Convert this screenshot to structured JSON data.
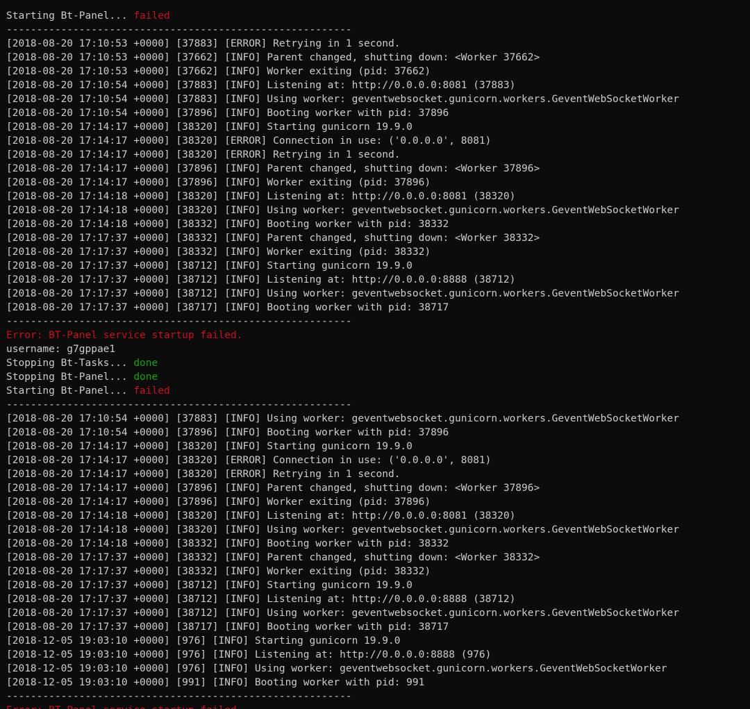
{
  "terminal": {
    "lines": [
      {
        "text": "",
        "status": "",
        "kind": "plain"
      },
      {
        "text": "Starting Bt-Panel... ",
        "status": "failed",
        "kind": "status"
      },
      {
        "text": "---------------------------------------------------------",
        "status": "",
        "kind": "sep"
      },
      {
        "text": "[2018-08-20 17:10:53 +0000] [37883] [ERROR] Retrying in 1 second.",
        "status": "",
        "kind": "plain"
      },
      {
        "text": "[2018-08-20 17:10:53 +0000] [37662] [INFO] Parent changed, shutting down: <Worker 37662>",
        "status": "",
        "kind": "plain"
      },
      {
        "text": "[2018-08-20 17:10:53 +0000] [37662] [INFO] Worker exiting (pid: 37662)",
        "status": "",
        "kind": "plain"
      },
      {
        "text": "[2018-08-20 17:10:54 +0000] [37883] [INFO] Listening at: http://0.0.0.0:8081 (37883)",
        "status": "",
        "kind": "plain"
      },
      {
        "text": "[2018-08-20 17:10:54 +0000] [37883] [INFO] Using worker: geventwebsocket.gunicorn.workers.GeventWebSocketWorker",
        "status": "",
        "kind": "plain"
      },
      {
        "text": "[2018-08-20 17:10:54 +0000] [37896] [INFO] Booting worker with pid: 37896",
        "status": "",
        "kind": "plain"
      },
      {
        "text": "[2018-08-20 17:14:17 +0000] [38320] [INFO] Starting gunicorn 19.9.0",
        "status": "",
        "kind": "plain"
      },
      {
        "text": "[2018-08-20 17:14:17 +0000] [38320] [ERROR] Connection in use: ('0.0.0.0', 8081)",
        "status": "",
        "kind": "plain"
      },
      {
        "text": "[2018-08-20 17:14:17 +0000] [38320] [ERROR] Retrying in 1 second.",
        "status": "",
        "kind": "plain"
      },
      {
        "text": "[2018-08-20 17:14:17 +0000] [37896] [INFO] Parent changed, shutting down: <Worker 37896>",
        "status": "",
        "kind": "plain"
      },
      {
        "text": "[2018-08-20 17:14:17 +0000] [37896] [INFO] Worker exiting (pid: 37896)",
        "status": "",
        "kind": "plain"
      },
      {
        "text": "[2018-08-20 17:14:18 +0000] [38320] [INFO] Listening at: http://0.0.0.0:8081 (38320)",
        "status": "",
        "kind": "plain"
      },
      {
        "text": "[2018-08-20 17:14:18 +0000] [38320] [INFO] Using worker: geventwebsocket.gunicorn.workers.GeventWebSocketWorker",
        "status": "",
        "kind": "plain"
      },
      {
        "text": "[2018-08-20 17:14:18 +0000] [38332] [INFO] Booting worker with pid: 38332",
        "status": "",
        "kind": "plain"
      },
      {
        "text": "[2018-08-20 17:17:37 +0000] [38332] [INFO] Parent changed, shutting down: <Worker 38332>",
        "status": "",
        "kind": "plain"
      },
      {
        "text": "[2018-08-20 17:17:37 +0000] [38332] [INFO] Worker exiting (pid: 38332)",
        "status": "",
        "kind": "plain"
      },
      {
        "text": "[2018-08-20 17:17:37 +0000] [38712] [INFO] Starting gunicorn 19.9.0",
        "status": "",
        "kind": "plain"
      },
      {
        "text": "[2018-08-20 17:17:37 +0000] [38712] [INFO] Listening at: http://0.0.0.0:8888 (38712)",
        "status": "",
        "kind": "plain"
      },
      {
        "text": "[2018-08-20 17:17:37 +0000] [38712] [INFO] Using worker: geventwebsocket.gunicorn.workers.GeventWebSocketWorker",
        "status": "",
        "kind": "plain"
      },
      {
        "text": "[2018-08-20 17:17:37 +0000] [38717] [INFO] Booting worker with pid: 38717",
        "status": "",
        "kind": "plain"
      },
      {
        "text": "---------------------------------------------------------",
        "status": "",
        "kind": "sep"
      },
      {
        "text": "Error: BT-Panel service startup failed.",
        "status": "",
        "kind": "error"
      },
      {
        "text": "username: g7gppae1",
        "status": "",
        "kind": "plain"
      },
      {
        "text": "Stopping Bt-Tasks... ",
        "status": "done",
        "kind": "status"
      },
      {
        "text": "Stopping Bt-Panel... ",
        "status": "done",
        "kind": "status"
      },
      {
        "text": "Starting Bt-Panel... ",
        "status": "failed",
        "kind": "status"
      },
      {
        "text": "---------------------------------------------------------",
        "status": "",
        "kind": "sep"
      },
      {
        "text": "[2018-08-20 17:10:54 +0000] [37883] [INFO] Using worker: geventwebsocket.gunicorn.workers.GeventWebSocketWorker",
        "status": "",
        "kind": "plain"
      },
      {
        "text": "[2018-08-20 17:10:54 +0000] [37896] [INFO] Booting worker with pid: 37896",
        "status": "",
        "kind": "plain"
      },
      {
        "text": "[2018-08-20 17:14:17 +0000] [38320] [INFO] Starting gunicorn 19.9.0",
        "status": "",
        "kind": "plain"
      },
      {
        "text": "[2018-08-20 17:14:17 +0000] [38320] [ERROR] Connection in use: ('0.0.0.0', 8081)",
        "status": "",
        "kind": "plain"
      },
      {
        "text": "[2018-08-20 17:14:17 +0000] [38320] [ERROR] Retrying in 1 second.",
        "status": "",
        "kind": "plain"
      },
      {
        "text": "[2018-08-20 17:14:17 +0000] [37896] [INFO] Parent changed, shutting down: <Worker 37896>",
        "status": "",
        "kind": "plain"
      },
      {
        "text": "[2018-08-20 17:14:17 +0000] [37896] [INFO] Worker exiting (pid: 37896)",
        "status": "",
        "kind": "plain"
      },
      {
        "text": "[2018-08-20 17:14:18 +0000] [38320] [INFO] Listening at: http://0.0.0.0:8081 (38320)",
        "status": "",
        "kind": "plain"
      },
      {
        "text": "[2018-08-20 17:14:18 +0000] [38320] [INFO] Using worker: geventwebsocket.gunicorn.workers.GeventWebSocketWorker",
        "status": "",
        "kind": "plain"
      },
      {
        "text": "[2018-08-20 17:14:18 +0000] [38332] [INFO] Booting worker with pid: 38332",
        "status": "",
        "kind": "plain"
      },
      {
        "text": "[2018-08-20 17:17:37 +0000] [38332] [INFO] Parent changed, shutting down: <Worker 38332>",
        "status": "",
        "kind": "plain"
      },
      {
        "text": "[2018-08-20 17:17:37 +0000] [38332] [INFO] Worker exiting (pid: 38332)",
        "status": "",
        "kind": "plain"
      },
      {
        "text": "[2018-08-20 17:17:37 +0000] [38712] [INFO] Starting gunicorn 19.9.0",
        "status": "",
        "kind": "plain"
      },
      {
        "text": "[2018-08-20 17:17:37 +0000] [38712] [INFO] Listening at: http://0.0.0.0:8888 (38712)",
        "status": "",
        "kind": "plain"
      },
      {
        "text": "[2018-08-20 17:17:37 +0000] [38712] [INFO] Using worker: geventwebsocket.gunicorn.workers.GeventWebSocketWorker",
        "status": "",
        "kind": "plain"
      },
      {
        "text": "[2018-08-20 17:17:37 +0000] [38717] [INFO] Booting worker with pid: 38717",
        "status": "",
        "kind": "plain"
      },
      {
        "text": "[2018-12-05 19:03:10 +0000] [976] [INFO] Starting gunicorn 19.9.0",
        "status": "",
        "kind": "plain"
      },
      {
        "text": "[2018-12-05 19:03:10 +0000] [976] [INFO] Listening at: http://0.0.0.0:8888 (976)",
        "status": "",
        "kind": "plain"
      },
      {
        "text": "[2018-12-05 19:03:10 +0000] [976] [INFO] Using worker: geventwebsocket.gunicorn.workers.GeventWebSocketWorker",
        "status": "",
        "kind": "plain"
      },
      {
        "text": "[2018-12-05 19:03:10 +0000] [991] [INFO] Booting worker with pid: 991",
        "status": "",
        "kind": "plain"
      },
      {
        "text": "---------------------------------------------------------",
        "status": "",
        "kind": "sep"
      },
      {
        "text": "Error: BT-Panel service startup failed.",
        "status": "",
        "kind": "error"
      }
    ]
  },
  "colors": {
    "background": "#0c0c0c",
    "foreground": "#cccccc",
    "error": "#c50f1f",
    "done": "#13a10e"
  }
}
